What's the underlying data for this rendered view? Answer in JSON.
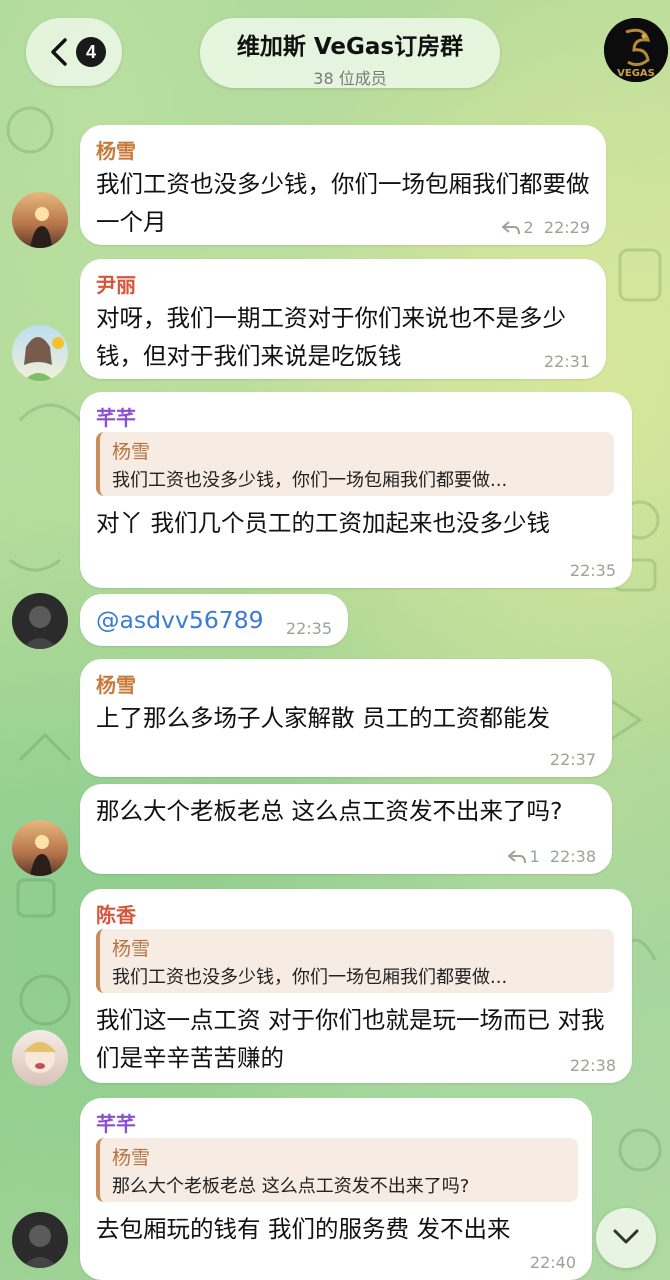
{
  "header": {
    "unread_count": "4",
    "group_title": "维加斯 VeGas订房群",
    "group_subtitle": "38 位成员",
    "group_avatar_text": "VEGAS"
  },
  "colors": {
    "name_yangxue": "#c9793a",
    "name_yinli": "#d6553d",
    "name_qianqian": "#8a4fd0",
    "name_chenxiang": "#d6553d",
    "quote_name": "#b7733f",
    "mention": "#3a7bd5"
  },
  "messages": [
    {
      "sender": "杨雪",
      "text": "我们工资也没多少钱，你们一场包厢我们都要做一个月",
      "replies": "2",
      "time": "22:29"
    },
    {
      "sender": "尹丽",
      "text": "对呀，我们一期工资对于你们来说也不是多少钱，但对于我们来说是吃饭钱",
      "time": "22:31"
    },
    {
      "sender": "芊芊",
      "quote_name": "杨雪",
      "quote_text": "我们工资也没多少钱，你们一场包厢我们都要做...",
      "text": "对丫 我们几个员工的工资加起来也没多少钱",
      "time": "22:35"
    },
    {
      "text": "@asdvv56789",
      "time": "22:35"
    },
    {
      "sender": "杨雪",
      "text": "上了那么多场子人家解散 员工的工资都能发",
      "time": "22:37"
    },
    {
      "text": "那么大个老板老总 这么点工资发不出来了吗?",
      "replies": "1",
      "time": "22:38"
    },
    {
      "sender": "陈香",
      "quote_name": "杨雪",
      "quote_text": "我们工资也没多少钱，你们一场包厢我们都要做...",
      "text": "我们这一点工资 对于你们也就是玩一场而已 对我们是辛辛苦苦赚的",
      "time": "22:38"
    },
    {
      "sender": "芊芊",
      "quote_name": "杨雪",
      "quote_text": "那么大个老板老总 这么点工资发不出来了吗?",
      "text": "去包厢玩的钱有 我们的服务费 发不出来",
      "time": "22:40"
    }
  ]
}
